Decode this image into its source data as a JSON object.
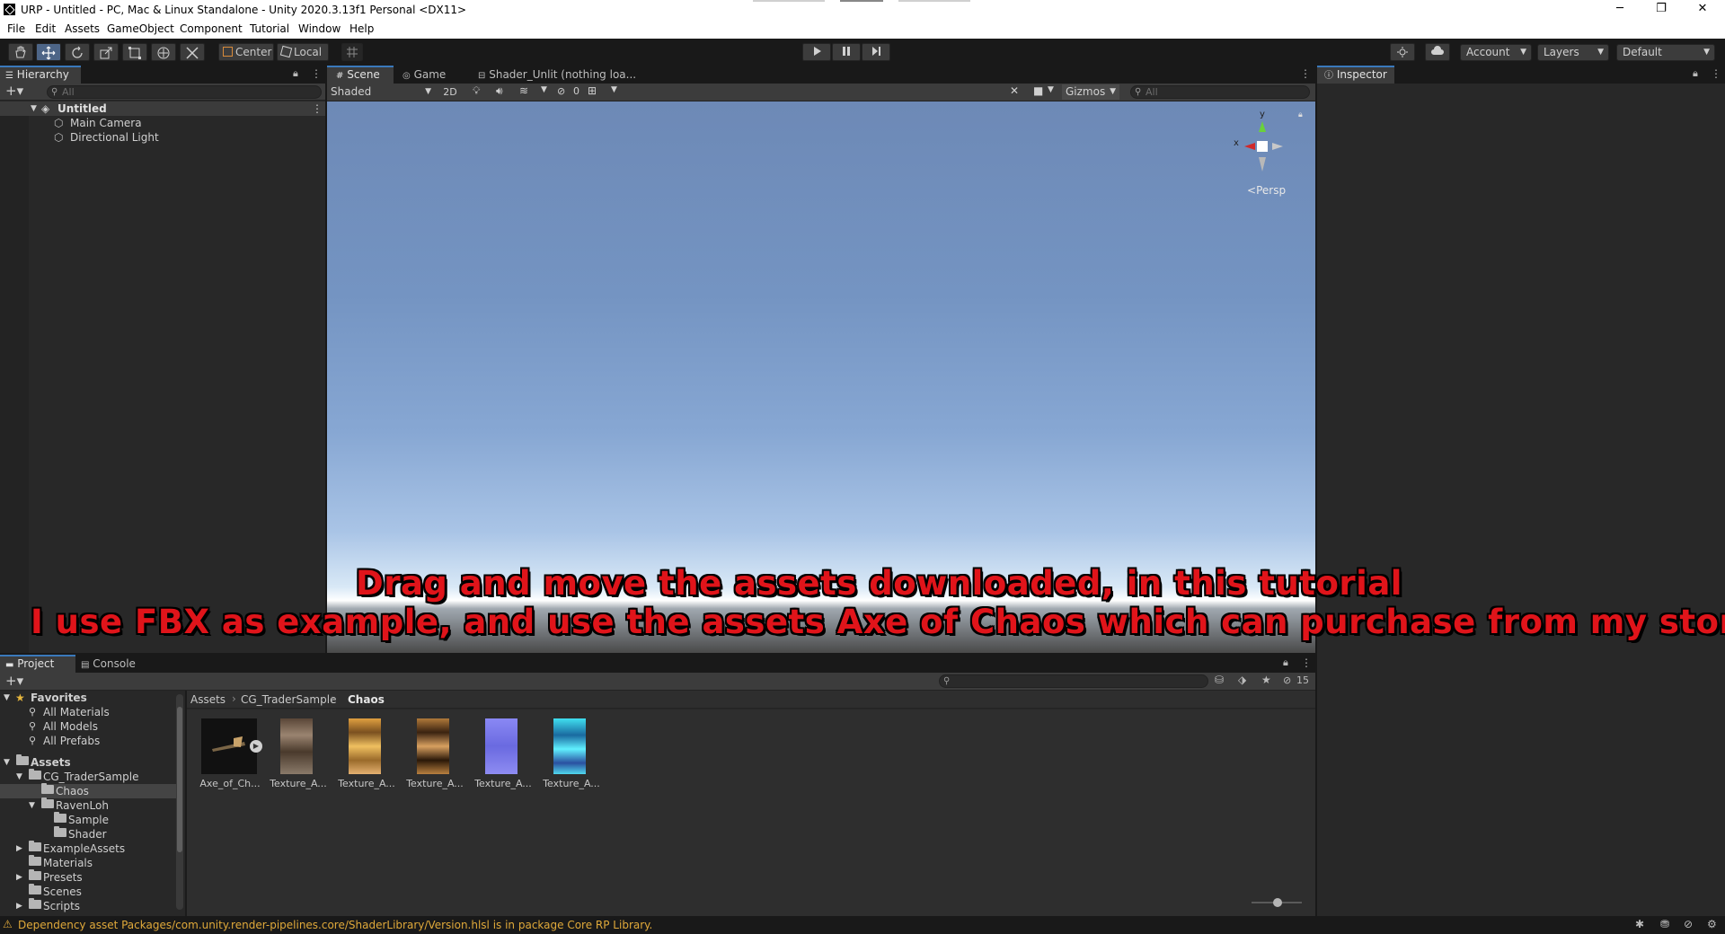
{
  "window": {
    "title": "URP - Untitled - PC, Mac & Linux Standalone - Unity 2020.3.13f1 Personal <DX11>",
    "minimize": "─",
    "restore": "❐",
    "close": "✕"
  },
  "menu": [
    "File",
    "Edit",
    "Assets",
    "GameObject",
    "Component",
    "Tutorial",
    "Window",
    "Help"
  ],
  "toolbar": {
    "pivot_mode": "Center",
    "pivot_rotation": "Local",
    "account": "Account",
    "layers": "Layers",
    "layout": "Default"
  },
  "hierarchy": {
    "tab": "Hierarchy",
    "search_placeholder": "All",
    "scene": "Untitled",
    "objects": [
      "Main Camera",
      "Directional Light"
    ]
  },
  "scene_tabs": [
    "Scene",
    "Game",
    "Shader_Unlit (nothing loa..."
  ],
  "scene_toolbar": {
    "draw_mode": "Shaded",
    "mode_2d": "2D",
    "hidden_count": "0",
    "gizmos": "Gizmos",
    "search_placeholder": "All"
  },
  "gizmo": {
    "axis_x": "x",
    "axis_y": "y",
    "projection": "Persp"
  },
  "inspector": {
    "tab": "Inspector"
  },
  "subtitles": [
    "Drag and move the assets downloaded, in this tutorial",
    "I use FBX as example, and use the assets Axe of Chaos which can purchase from my store"
  ],
  "project": {
    "tabs": [
      "Project",
      "Console"
    ],
    "visible_count": "15",
    "favorites_label": "Favorites",
    "favorites": [
      "All Materials",
      "All Models",
      "All Prefabs"
    ],
    "assets_label": "Assets",
    "tree": [
      "CG_TraderSample",
      "Chaos",
      "RavenLoh",
      "Sample",
      "Shader",
      "ExampleAssets",
      "Materials",
      "Presets",
      "Scenes",
      "Scripts"
    ],
    "breadcrumb": [
      "Assets",
      "CG_TraderSample",
      "Chaos"
    ],
    "items": [
      {
        "name": "Axe_of_Ch...",
        "color": "#111111"
      },
      {
        "name": "Texture_A...",
        "color": "#8a6a4a"
      },
      {
        "name": "Texture_A...",
        "color": "#d89b3c"
      },
      {
        "name": "Texture_A...",
        "color": "#6b4526"
      },
      {
        "name": "Texture_A...",
        "color": "#7d7ff0"
      },
      {
        "name": "Texture_A...",
        "color": "#3fd3e6"
      }
    ]
  },
  "status": {
    "message": "Dependency asset Packages/com.unity.render-pipelines.core/ShaderLibrary/Version.hlsl is in package Core RP Library."
  },
  "colors": {
    "accent": "#3a79bb",
    "warning": "#e0a93a",
    "subtitle": "#e0141a"
  }
}
